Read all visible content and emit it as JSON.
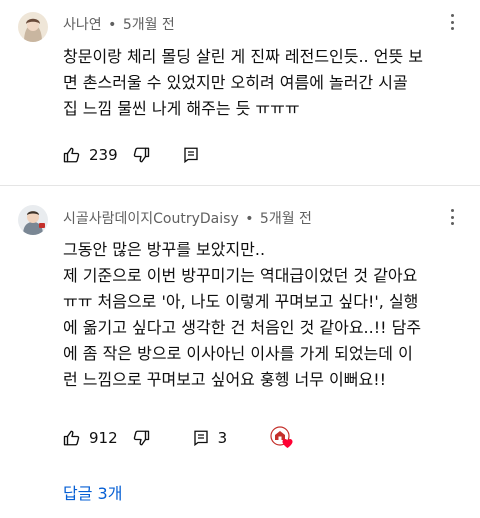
{
  "comments": [
    {
      "author": "사나연",
      "separator": "•",
      "time": "5개월 전",
      "lines": [
        "창문이랑 체리 몰딩 살린 게 진짜 레전드인듯.. 언뜻 보",
        "면 촌스러울 수 있었지만 오히려 여름에 놀러간 시골",
        "집 느낌 물씬 나게 해주는 듯 ㅠㅠㅠ"
      ],
      "likes": "239",
      "reply_count": ""
    },
    {
      "author": "시골사람데이지CoutryDaisy",
      "separator": "•",
      "time": "5개월 전",
      "lines": [
        "그동안 많은 방꾸를 보았지만..",
        "제 기준으로 이번 방꾸미기는 역대급이었던 것 같아요",
        "ㅠㅠ 처음으로 '아, 나도 이렇게 꾸며보고 싶다!', 실행",
        "에 옮기고 싶다고 생각한 건 처음인 것 같아요..!! 담주",
        "에 좀 작은 방으로 이사아닌 이사를 가게 되었는데 이",
        "런 느낌으로 꾸며보고 싶어요 훙헹 너무 이뻐요!!"
      ],
      "likes": "912",
      "reply_count": "3"
    }
  ],
  "replies_link": "답글 3개",
  "colors": {
    "link": "#065fd4",
    "meta": "#606060",
    "heart": "#ff0033",
    "avatar_badge": "#c4302b"
  },
  "icons": {
    "like": "thumbs-up-icon",
    "dislike": "thumbs-down-icon",
    "reply": "reply-icon",
    "more": "kebab-menu-icon",
    "creator_heart": "creator-heart-icon"
  }
}
